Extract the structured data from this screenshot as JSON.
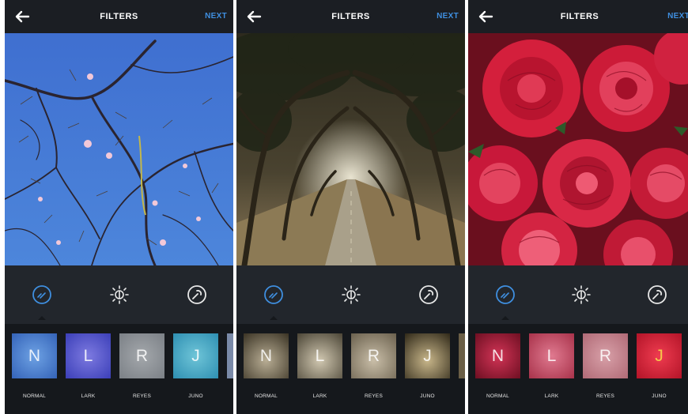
{
  "screens": [
    {
      "header": {
        "title": "FILTERS",
        "next_label": "NEXT"
      },
      "photo": "magnolia-branches-sky",
      "filters": [
        {
          "letter": "N",
          "label": "NORMAL"
        },
        {
          "letter": "L",
          "label": "LARK"
        },
        {
          "letter": "R",
          "label": "REYES"
        },
        {
          "letter": "J",
          "label": "JUNO"
        }
      ]
    },
    {
      "header": {
        "title": "FILTERS",
        "next_label": "NEXT"
      },
      "photo": "tree-tunnel-road",
      "filters": [
        {
          "letter": "N",
          "label": "NORMAL"
        },
        {
          "letter": "L",
          "label": "LARK"
        },
        {
          "letter": "R",
          "label": "REYES"
        },
        {
          "letter": "J",
          "label": "JUNO"
        }
      ]
    },
    {
      "header": {
        "title": "FILTERS",
        "next_label": "NEXT"
      },
      "photo": "red-roses",
      "filters": [
        {
          "letter": "N",
          "label": "NORMAL"
        },
        {
          "letter": "L",
          "label": "LARK"
        },
        {
          "letter": "R",
          "label": "REYES"
        },
        {
          "letter": "J",
          "label": "JUNO"
        }
      ]
    }
  ],
  "icons": {
    "back": "back-arrow-icon",
    "filter_tool": "filter-tool-icon",
    "brightness_tool": "brightness-icon",
    "edit_tool": "wrench-icon"
  },
  "colors": {
    "accent": "#3f8fe0",
    "toolbar": "#22262c",
    "strip": "#15181c"
  }
}
